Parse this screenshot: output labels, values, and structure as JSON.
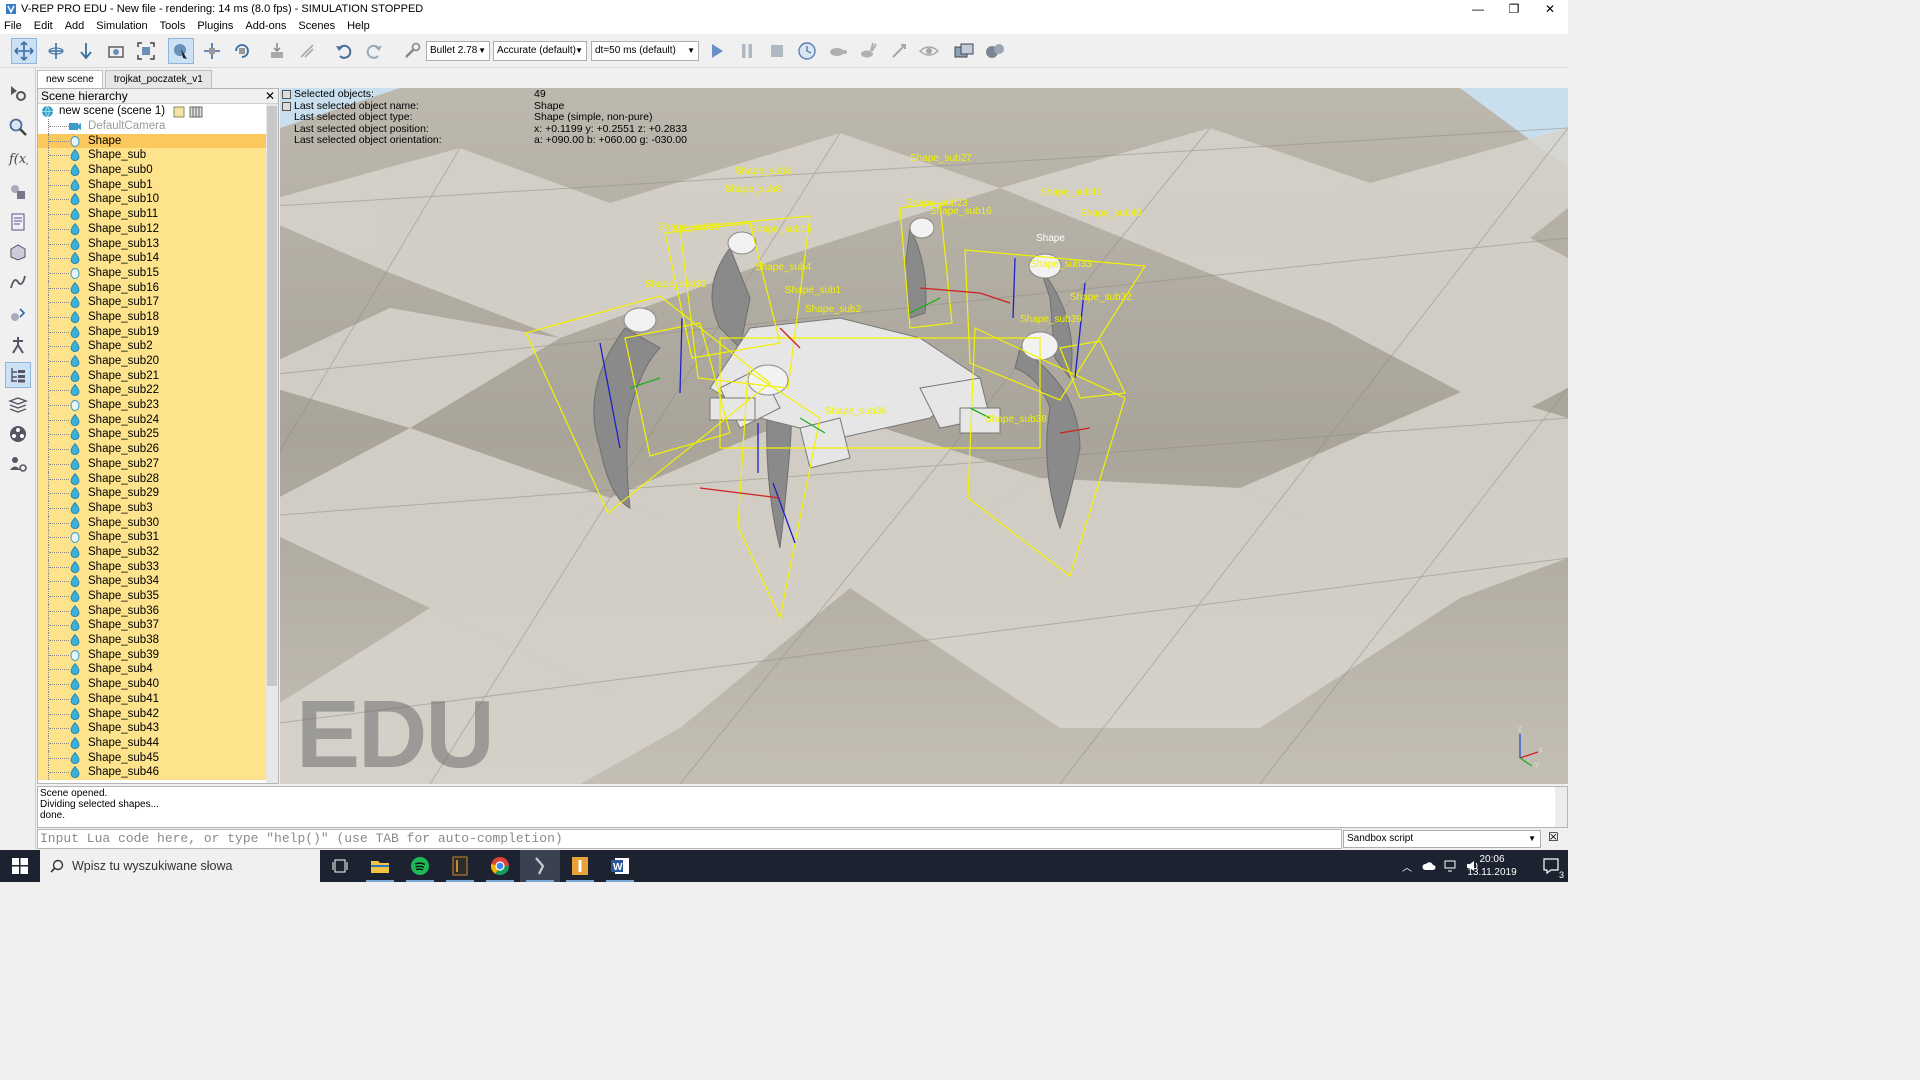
{
  "window": {
    "title": "V-REP PRO EDU - New file - rendering: 14 ms (8.0 fps) - SIMULATION STOPPED",
    "minimize": "—",
    "maximize": "❐",
    "close": "✕"
  },
  "menu": [
    "File",
    "Edit",
    "Add",
    "Simulation",
    "Tools",
    "Plugins",
    "Add-ons",
    "Scenes",
    "Help"
  ],
  "toolbar": {
    "engine": "Bullet 2.78",
    "accuracy": "Accurate (default)",
    "dt": "dt=50 ms (default)"
  },
  "tabs": [
    {
      "label": "new scene",
      "active": true
    },
    {
      "label": "trojkat_poczatek_v1",
      "active": false
    }
  ],
  "hierarchy": {
    "title": "Scene hierarchy",
    "close": "✕",
    "root": "new scene (scene 1)",
    "camera": "DefaultCamera",
    "items": [
      "Shape",
      "Shape_sub",
      "Shape_sub0",
      "Shape_sub1",
      "Shape_sub10",
      "Shape_sub11",
      "Shape_sub12",
      "Shape_sub13",
      "Shape_sub14",
      "Shape_sub15",
      "Shape_sub16",
      "Shape_sub17",
      "Shape_sub18",
      "Shape_sub19",
      "Shape_sub2",
      "Shape_sub20",
      "Shape_sub21",
      "Shape_sub22",
      "Shape_sub23",
      "Shape_sub24",
      "Shape_sub25",
      "Shape_sub26",
      "Shape_sub27",
      "Shape_sub28",
      "Shape_sub29",
      "Shape_sub3",
      "Shape_sub30",
      "Shape_sub31",
      "Shape_sub32",
      "Shape_sub33",
      "Shape_sub34",
      "Shape_sub35",
      "Shape_sub36",
      "Shape_sub37",
      "Shape_sub38",
      "Shape_sub39",
      "Shape_sub4",
      "Shape_sub40",
      "Shape_sub41",
      "Shape_sub42",
      "Shape_sub43",
      "Shape_sub44",
      "Shape_sub45",
      "Shape_sub46"
    ]
  },
  "info": [
    {
      "label": "Selected objects:",
      "value": "49"
    },
    {
      "label": "Last selected object name:",
      "value": "Shape"
    },
    {
      "label": "Last selected object type:",
      "value": "Shape (simple, non-pure)"
    },
    {
      "label": "Last selected object position:",
      "value": "x: +0.1199   y: +0.2551   z: +0.2833"
    },
    {
      "label": "Last selected object orientation:",
      "value": "a: +090.00   b: +060.00   g: -030.00"
    }
  ],
  "viewport": {
    "watermark": "EDU",
    "axis_x": "x",
    "axis_y": "y",
    "axis_z": "z",
    "labels": [
      "Shape_sub3",
      "Shape_sub6",
      "Shape_sub27",
      "Shape_sub23",
      "Shape_sub16",
      "Shape_sub41",
      "Shape_sub40",
      "Shape_sub25",
      "Shape_sub15",
      "Shape",
      "Shape_sub4",
      "Shape_sub33",
      "Shape_sub31",
      "Shape_sub1",
      "Shape_sub32",
      "Shape_sub2",
      "Shape_sub39",
      "Shape_sub38",
      "Shape_sub36",
      "Shape_sub8"
    ]
  },
  "console": {
    "lines": [
      "Scene opened.",
      "Dividing selected shapes...",
      "done."
    ],
    "placeholder": "Input Lua code here, or type \"help()\" (use TAB for auto-completion)",
    "script_mode": "Sandbox script"
  },
  "taskbar": {
    "search_placeholder": "Wpisz tu wyszukiwane słowa",
    "time": "20:06",
    "date": "13.11.2019",
    "notifications": "3"
  },
  "colors": {
    "selection": "#fde38c",
    "selection_current": "#fbc85e",
    "bbox": "#f2f200",
    "taskbar": "#1c2230"
  }
}
